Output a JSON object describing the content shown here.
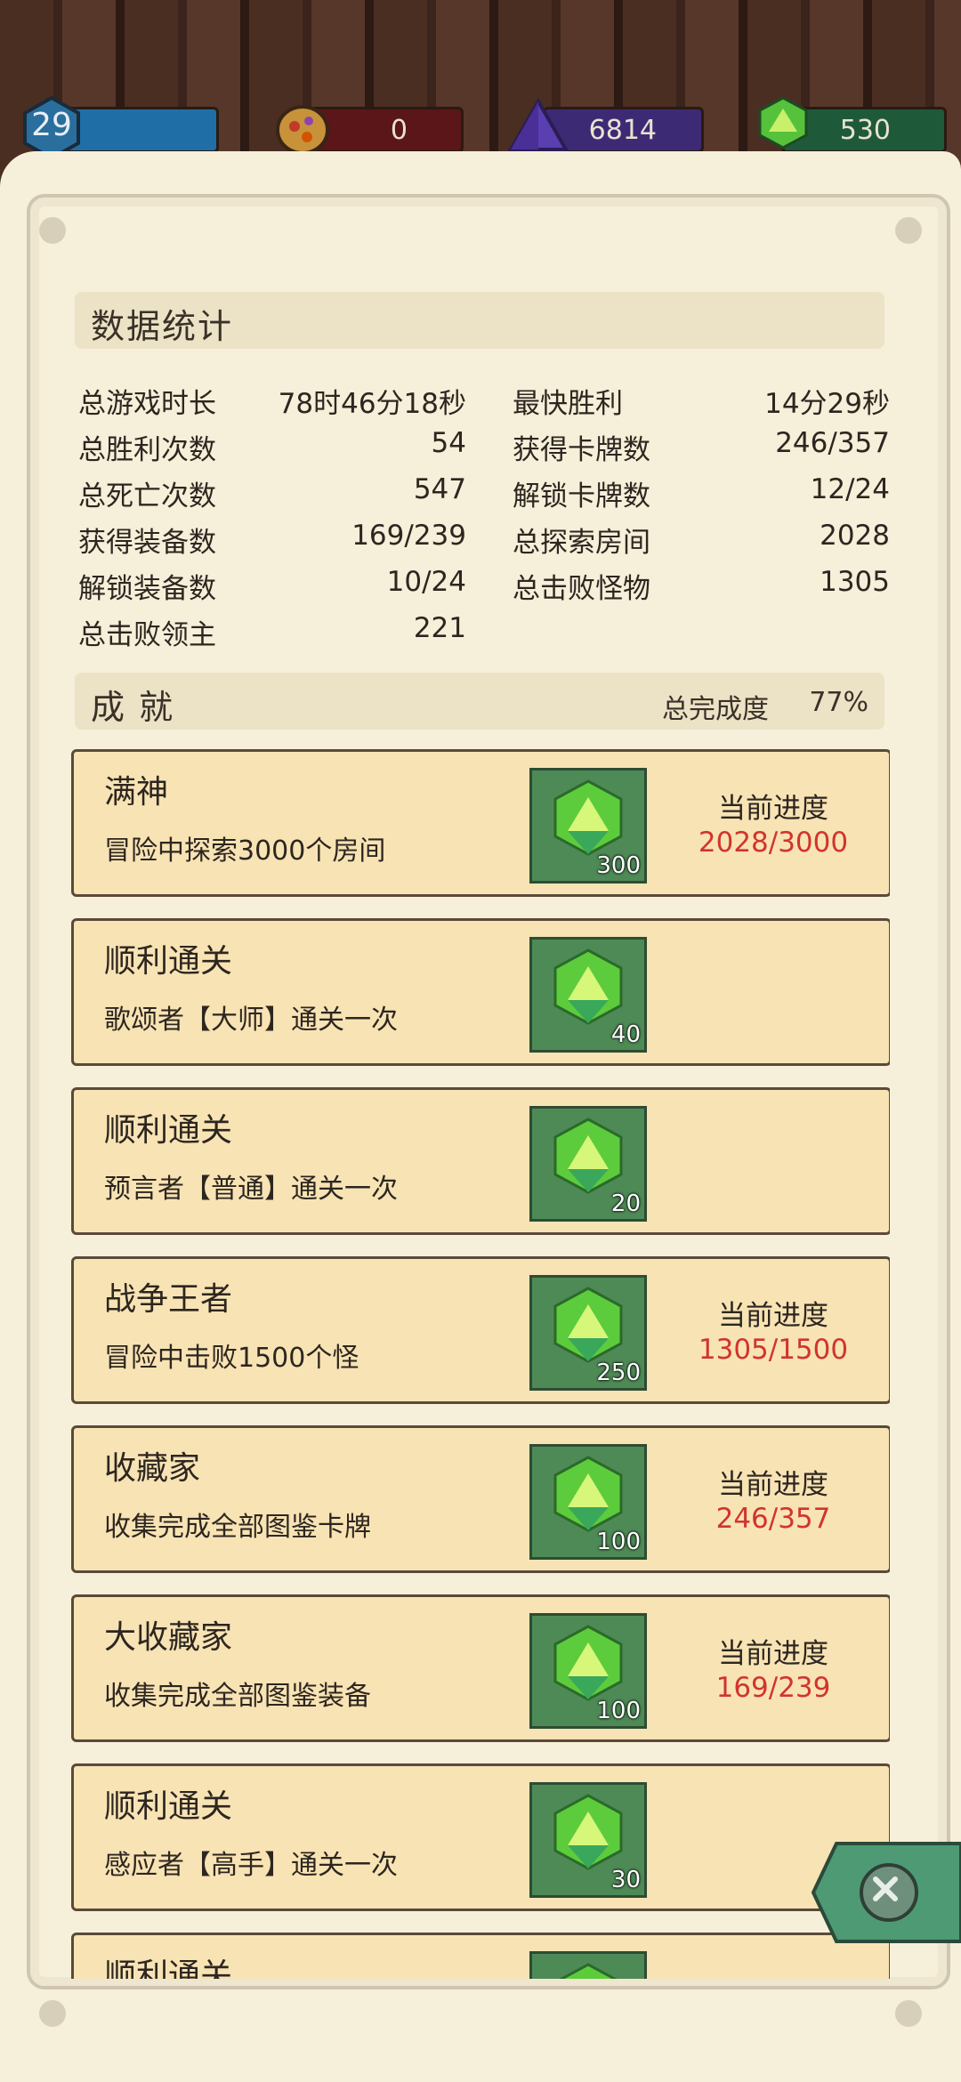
{
  "resources": {
    "level": "29",
    "red": "0",
    "purple": "6814",
    "green": "530"
  },
  "stats_section": {
    "title": "数据统计",
    "rows": [
      {
        "l1": "总游戏时长",
        "v1": "78时46分18秒",
        "l2": "最快胜利",
        "v2": "14分29秒"
      },
      {
        "l1": "总胜利次数",
        "v1": "54",
        "l2": "获得卡牌数",
        "v2": "246/357"
      },
      {
        "l1": "总死亡次数",
        "v1": "547",
        "l2": "解锁卡牌数",
        "v2": "12/24"
      },
      {
        "l1": "获得装备数",
        "v1": "169/239",
        "l2": "总探索房间",
        "v2": "2028"
      },
      {
        "l1": "解锁装备数",
        "v1": "10/24",
        "l2": "总击败怪物",
        "v2": "1305"
      },
      {
        "l1": "总击败领主",
        "v1": "221",
        "l2": "",
        "v2": ""
      }
    ]
  },
  "achievements_section": {
    "title": "成 就",
    "completion_label": "总完成度",
    "completion_value": "77%",
    "items": [
      {
        "name": "满神",
        "desc": "冒险中探索3000个房间",
        "reward": "300",
        "progress_label": "当前进度",
        "progress": "2028/3000"
      },
      {
        "name": "顺利通关",
        "desc": "歌颂者【大师】通关一次",
        "reward": "40",
        "progress_label": "",
        "progress": ""
      },
      {
        "name": "顺利通关",
        "desc": "预言者【普通】通关一次",
        "reward": "20",
        "progress_label": "",
        "progress": ""
      },
      {
        "name": "战争王者",
        "desc": "冒险中击败1500个怪",
        "reward": "250",
        "progress_label": "当前进度",
        "progress": "1305/1500"
      },
      {
        "name": "收藏家",
        "desc": "收集完成全部图鉴卡牌",
        "reward": "100",
        "progress_label": "当前进度",
        "progress": "246/357"
      },
      {
        "name": "大收藏家",
        "desc": "收集完成全部图鉴装备",
        "reward": "100",
        "progress_label": "当前进度",
        "progress": "169/239"
      },
      {
        "name": "顺利通关",
        "desc": "感应者【高手】通关一次",
        "reward": "30",
        "progress_label": "",
        "progress": ""
      },
      {
        "name": "顺利通关",
        "desc": "",
        "reward": "",
        "progress_label": "",
        "progress": ""
      }
    ]
  },
  "colors": {
    "parchment": "#f6efd9",
    "card": "#f8e3b4",
    "progress_text": "#d1342f",
    "reward_tile": "#4e8a56"
  },
  "icons": {
    "level": "hexagon-level-icon",
    "red": "rock-ore-icon",
    "purple": "purple-crystal-icon",
    "green": "green-gem-icon",
    "reward": "green-gem-icon",
    "close": "close-icon"
  }
}
